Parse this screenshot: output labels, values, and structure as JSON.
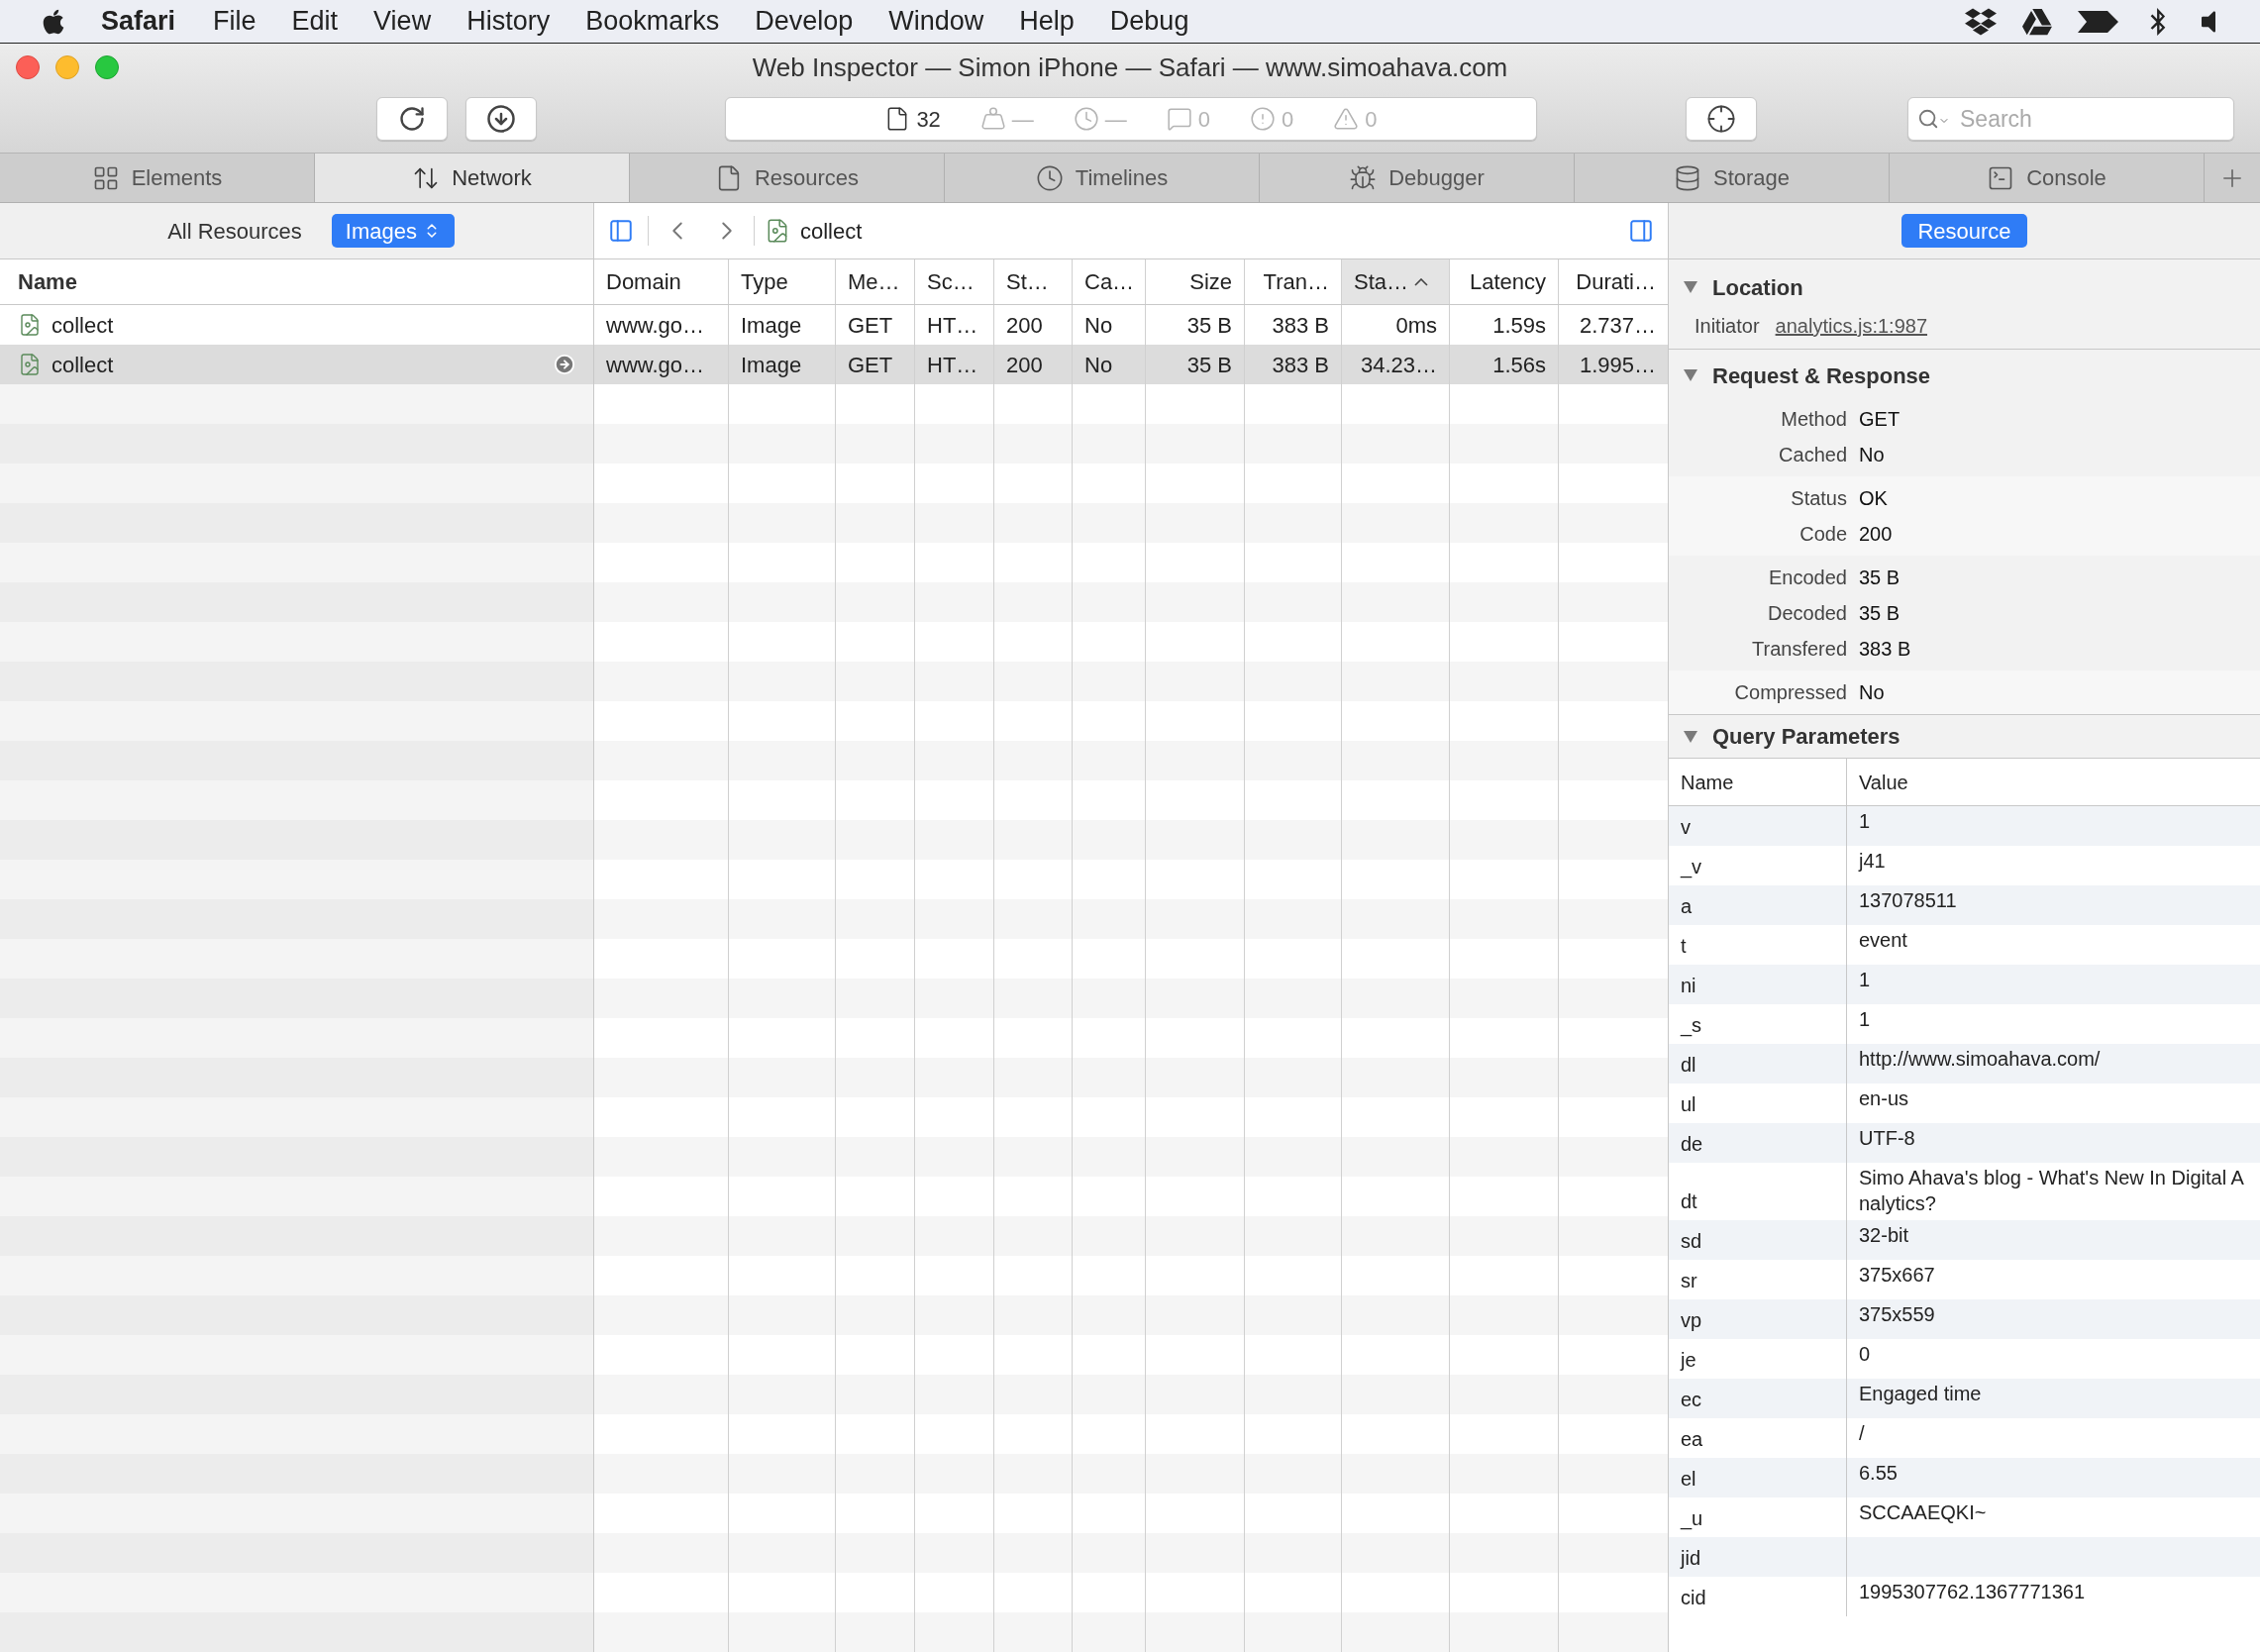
{
  "menu_bar": {
    "app": "Safari",
    "menus": [
      "File",
      "Edit",
      "View",
      "History",
      "Bookmarks",
      "Develop",
      "Window",
      "Help",
      "Debug"
    ]
  },
  "window": {
    "title": "Web Inspector — Simon iPhone — Safari — www.simoahava.com"
  },
  "toolbar": {
    "indicators": [
      {
        "kind": "resources",
        "text": "32",
        "active": true
      },
      {
        "kind": "load",
        "text": "—",
        "active": false
      },
      {
        "kind": "time",
        "text": "—",
        "active": false
      },
      {
        "kind": "logs",
        "text": "0",
        "active": false
      },
      {
        "kind": "errors",
        "text": "0",
        "active": false
      },
      {
        "kind": "warnings",
        "text": "0",
        "active": false
      }
    ],
    "search": {
      "placeholder": "Search"
    }
  },
  "tabs": [
    {
      "kind": "elements",
      "label": "Elements",
      "selected": false
    },
    {
      "kind": "network",
      "label": "Network",
      "selected": true
    },
    {
      "kind": "resources",
      "label": "Resources",
      "selected": false
    },
    {
      "kind": "timelines",
      "label": "Timelines",
      "selected": false
    },
    {
      "kind": "debugger",
      "label": "Debugger",
      "selected": false
    },
    {
      "kind": "storage",
      "label": "Storage",
      "selected": false
    },
    {
      "kind": "console",
      "label": "Console",
      "selected": false
    }
  ],
  "filter": [
    {
      "label": "All Resources",
      "selected": false
    },
    {
      "label": "Images",
      "selected": true
    }
  ],
  "breadcrumb": "collect",
  "name_list": {
    "header": "Name",
    "rows": [
      {
        "name": "collect",
        "selected": false
      },
      {
        "name": "collect",
        "selected": true
      }
    ]
  },
  "table": {
    "columns": [
      {
        "label": "Domain",
        "sorted": false
      },
      {
        "label": "Type",
        "sorted": false
      },
      {
        "label": "Me…",
        "sorted": false
      },
      {
        "label": "Sc…",
        "sorted": false
      },
      {
        "label": "St…",
        "sorted": false
      },
      {
        "label": "Ca…",
        "sorted": false
      },
      {
        "label": "Size",
        "sorted": false
      },
      {
        "label": "Tran…",
        "sorted": false
      },
      {
        "label": "Sta…",
        "sorted": true
      },
      {
        "label": "Latency",
        "sorted": false
      },
      {
        "label": "Durati…",
        "sorted": false
      }
    ],
    "rows": [
      {
        "selected": false,
        "cells": [
          "www.go…",
          "Image",
          "GET",
          "HT…",
          "200",
          "No",
          "35 B",
          "383 B",
          "0ms",
          "1.59s",
          "2.737…"
        ]
      },
      {
        "selected": true,
        "cells": [
          "www.go…",
          "Image",
          "GET",
          "HT…",
          "200",
          "No",
          "35 B",
          "383 B",
          "34.23…",
          "1.56s",
          "1.995…"
        ]
      }
    ]
  },
  "details": {
    "tab": {
      "label": "Resource",
      "selected": true
    },
    "location": {
      "title": "Location",
      "expanded": true,
      "initiator_label": "Initiator",
      "initiator_link": "analytics.js:1:987"
    },
    "request_response": {
      "title": "Request & Response",
      "expanded": true,
      "groups": [
        [
          {
            "label": "Method",
            "value": "GET"
          },
          {
            "label": "Cached",
            "value": "No"
          }
        ],
        [
          {
            "label": "Status",
            "value": "OK"
          },
          {
            "label": "Code",
            "value": "200"
          }
        ],
        [
          {
            "label": "Encoded",
            "value": "35 B"
          },
          {
            "label": "Decoded",
            "value": "35 B"
          },
          {
            "label": "Transfered",
            "value": "383 B"
          }
        ],
        [
          {
            "label": "Compressed",
            "value": "No"
          }
        ]
      ]
    },
    "query_parameters": {
      "title": "Query Parameters",
      "expanded": true,
      "columns": [
        "Name",
        "Value"
      ],
      "rows": [
        {
          "name": "v",
          "value": "1"
        },
        {
          "name": "_v",
          "value": "j41"
        },
        {
          "name": "a",
          "value": "137078511"
        },
        {
          "name": "t",
          "value": "event"
        },
        {
          "name": "ni",
          "value": "1"
        },
        {
          "name": "_s",
          "value": "1"
        },
        {
          "name": "dl",
          "value": "http://www.simoahava.com/"
        },
        {
          "name": "ul",
          "value": "en-us"
        },
        {
          "name": "de",
          "value": "UTF-8"
        },
        {
          "name": "dt",
          "value": "Simo Ahava's blog - What's New In Digital Analytics?"
        },
        {
          "name": "sd",
          "value": "32-bit"
        },
        {
          "name": "sr",
          "value": "375x667"
        },
        {
          "name": "vp",
          "value": "375x559"
        },
        {
          "name": "je",
          "value": "0"
        },
        {
          "name": "ec",
          "value": "Engaged time"
        },
        {
          "name": "ea",
          "value": "/"
        },
        {
          "name": "el",
          "value": "6.55"
        },
        {
          "name": "_u",
          "value": "SCCAAEQKI~"
        },
        {
          "name": "jid"
        },
        {
          "name": "cid",
          "value": "1995307762.1367771361"
        }
      ]
    }
  }
}
